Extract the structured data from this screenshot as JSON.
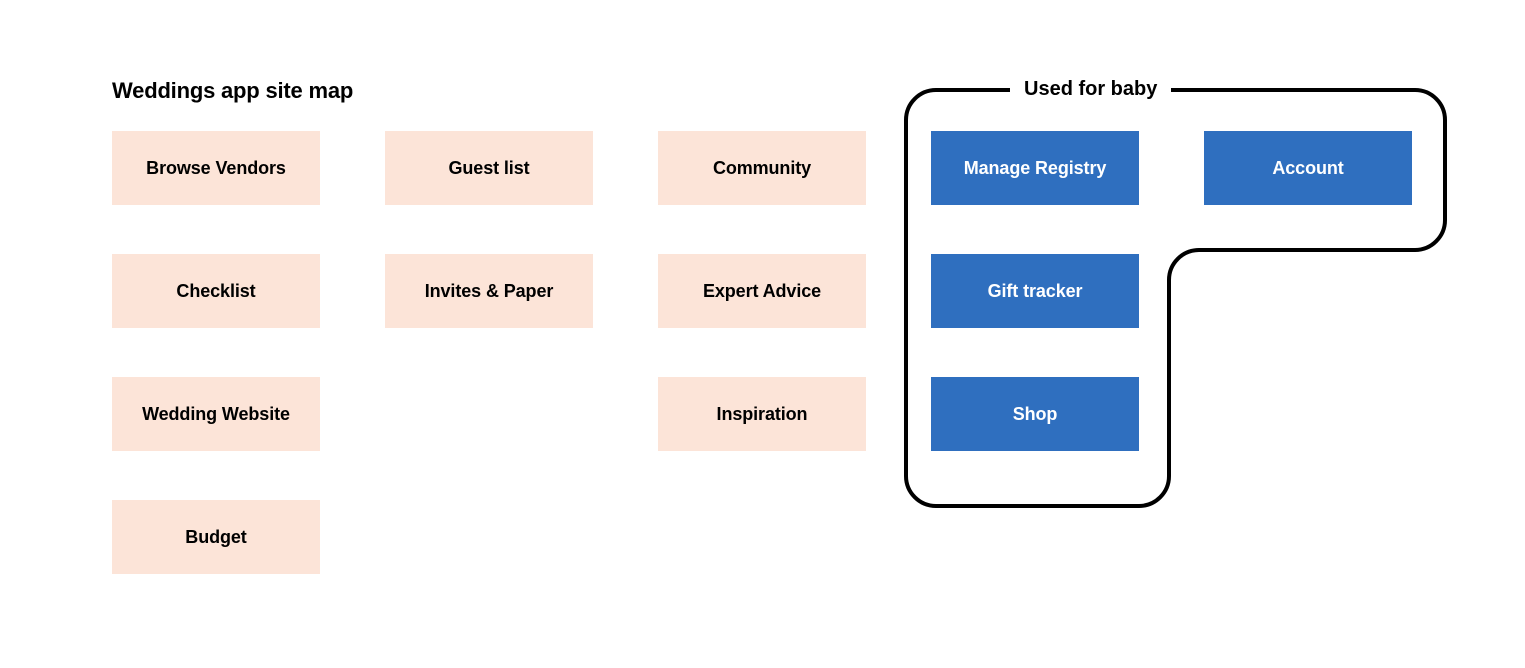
{
  "title": "Weddings app site map",
  "group_label": "Used for baby",
  "columns": {
    "c1": {
      "r1": "Browse Vendors",
      "r2": "Checklist",
      "r3": "Wedding Website",
      "r4": "Budget"
    },
    "c2": {
      "r1": "Guest list",
      "r2": "Invites & Paper"
    },
    "c3": {
      "r1": "Community",
      "r2": "Expert Advice",
      "r3": "Inspiration"
    },
    "c4": {
      "r1": "Manage Registry",
      "r2": "Gift tracker",
      "r3": "Shop"
    },
    "c5": {
      "r1": "Account"
    }
  },
  "colors": {
    "pink": "#fce4d8",
    "blue": "#2f6fbf"
  }
}
